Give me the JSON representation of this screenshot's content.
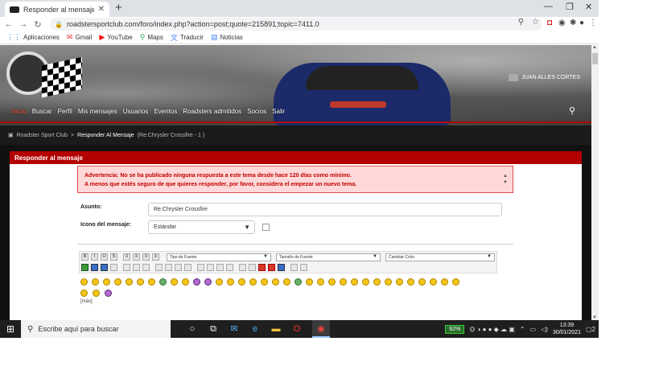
{
  "browser": {
    "tab_title": "Responder al mensaje",
    "url": "roadstersportclub.com/foro/index.php?action=post;quote=215891;topic=7411.0",
    "bookmarks": [
      {
        "label": "Aplicaciones",
        "icon": "apps-grid-icon"
      },
      {
        "label": "Gmail",
        "icon": "gmail-icon"
      },
      {
        "label": "YouTube",
        "icon": "youtube-icon"
      },
      {
        "label": "Maps",
        "icon": "maps-icon"
      },
      {
        "label": "Traducir",
        "icon": "translate-icon"
      },
      {
        "label": "Noticias",
        "icon": "news-icon"
      }
    ]
  },
  "site": {
    "nav": [
      "Inicio",
      "Buscar",
      "Perfil",
      "Mis mensajes",
      "Usuarios",
      "Eventos",
      "Roadsters admitidos",
      "Socios",
      "Salir"
    ],
    "user_name": "JUAN ALLES CORTES",
    "breadcrumb": {
      "home": "Roadster Sport Club",
      "separator": ">",
      "current": "Responder Al Mensaje",
      "suffix": "(Re:Chrysler Crossfire - 1 )"
    }
  },
  "form": {
    "panel_title": "Responder al mensaje",
    "warning_line1": "Advertencia: No se ha publicado ninguna respuesta a este tema desde hace 120 días como mínimo.",
    "warning_line2": "A menos que estés seguro de que quieres responder, por favor, considera el empezar un nuevo tema.",
    "subject_label": "Asunto:",
    "subject_value": "Re:Chrysler Crossfire",
    "icon_label": "Icono del mensaje:",
    "icon_value": "Estándar",
    "font_type": "Tipo de Fuente",
    "font_size": "Tamaño de Fuente",
    "font_color": "Cambiar Color",
    "more_label": "[más]"
  },
  "taskbar": {
    "search_placeholder": "Escribe aquí para buscar",
    "battery": "92%",
    "time": "13:39",
    "date": "30/01/2021",
    "notifications": "2"
  }
}
